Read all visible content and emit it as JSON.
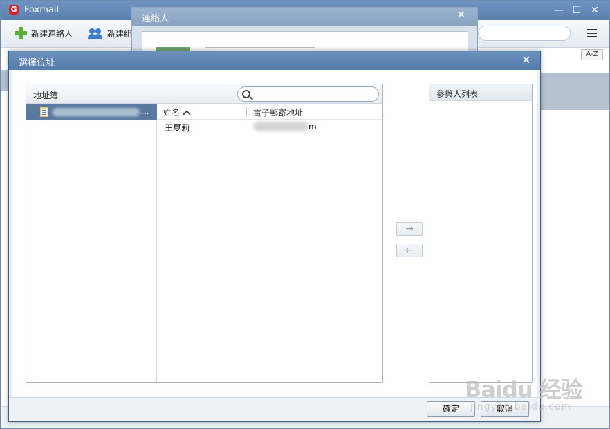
{
  "main_window": {
    "title": "Foxmail",
    "toolbar": {
      "new_contact_label": "新建連絡人",
      "new_group_label": "新建組"
    },
    "az_label": "A-Z"
  },
  "contacts_dialog": {
    "title": "連絡人"
  },
  "select_dialog": {
    "title": "選擇位址",
    "addressbook_label": "地址簿",
    "search": {
      "placeholder": ""
    },
    "book_item_suffix": "...",
    "columns": {
      "name": "姓名",
      "email": "電子郵寄地址"
    },
    "contacts": [
      {
        "name": "王夏莉",
        "email_visible_suffix": "m"
      }
    ],
    "arrow_add": "→",
    "arrow_remove": "←",
    "participant_label": "參與人列表",
    "ok_label": "確定",
    "cancel_label": "取消"
  },
  "watermark": {
    "brand": "Baidu 经验",
    "sub": "jingyan.baidu.com"
  }
}
